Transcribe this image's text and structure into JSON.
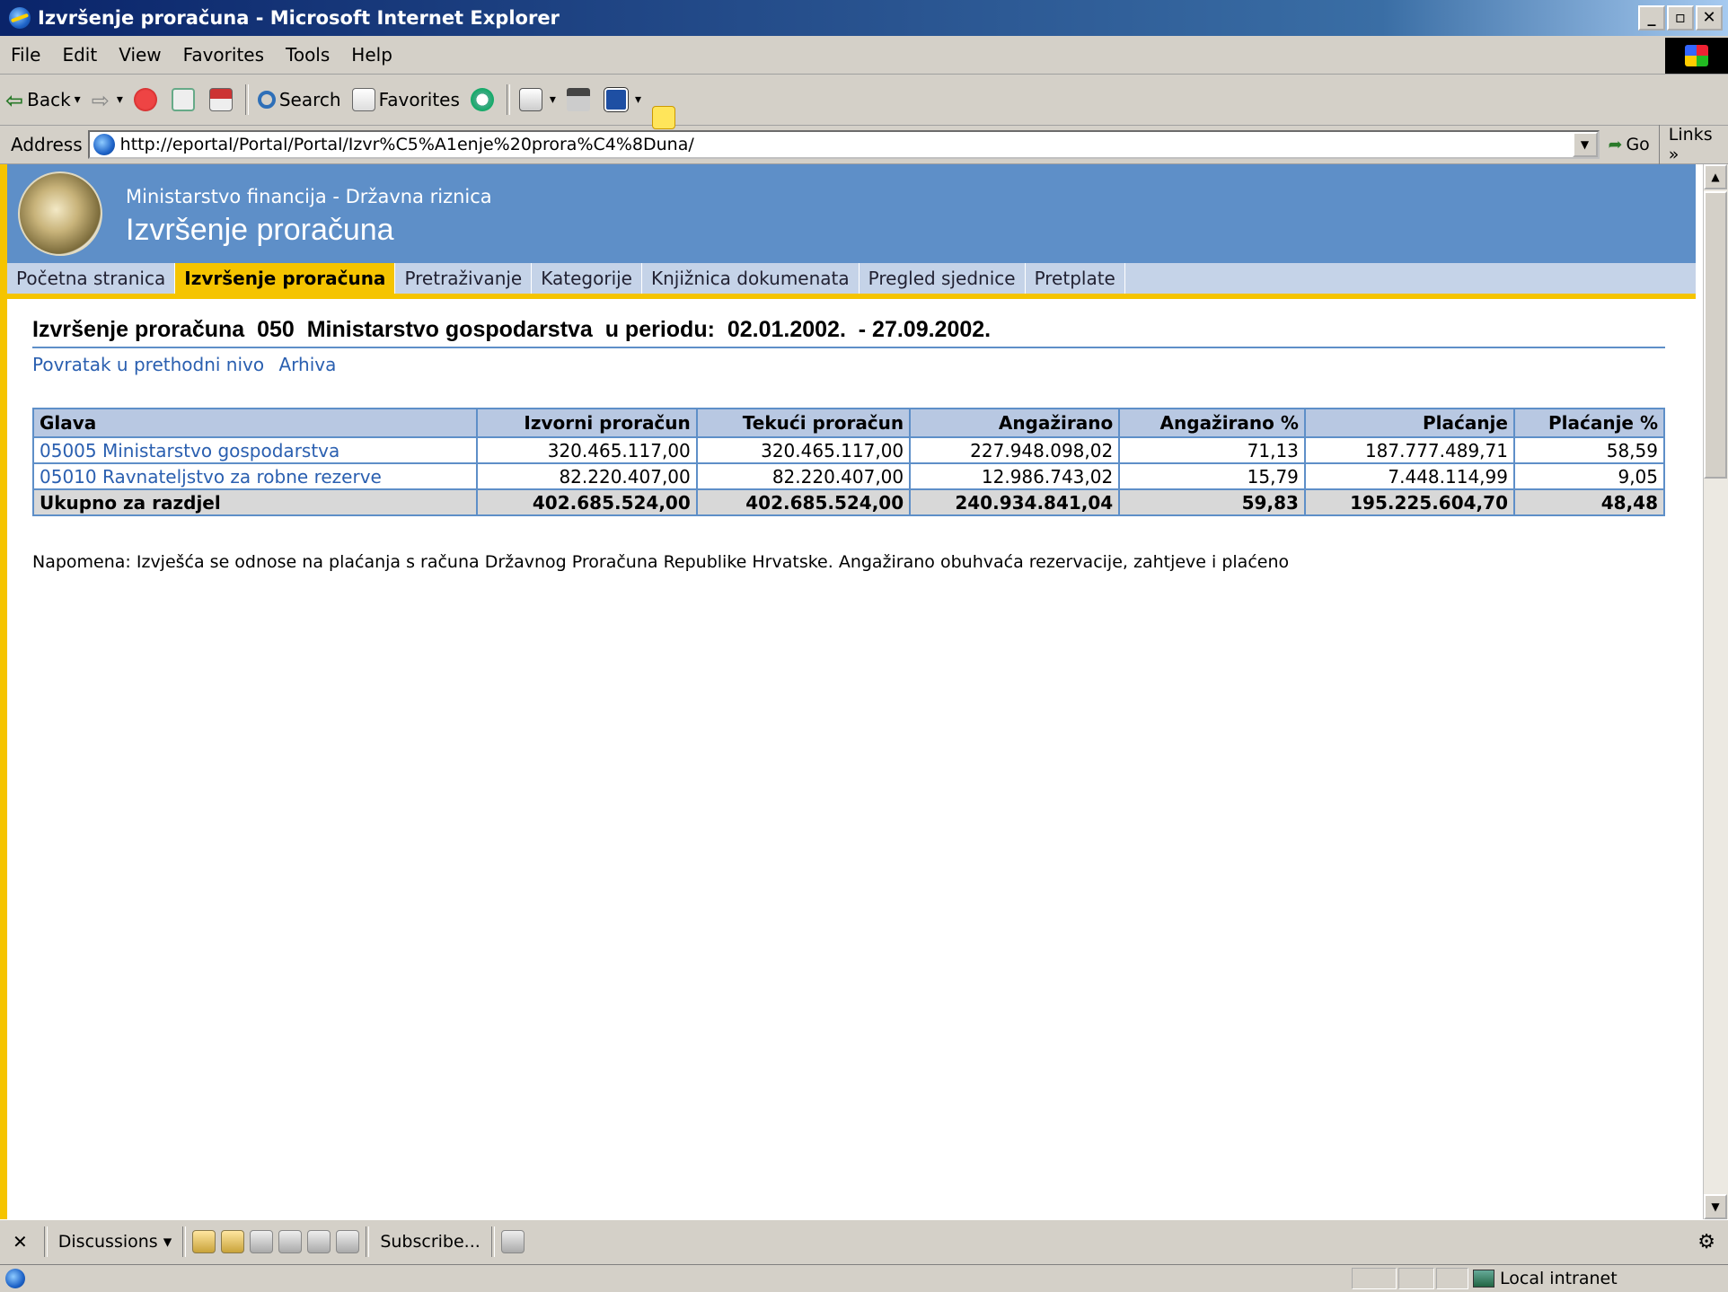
{
  "window": {
    "title": "Izvršenje proračuna - Microsoft Internet Explorer"
  },
  "menu": [
    "File",
    "Edit",
    "View",
    "Favorites",
    "Tools",
    "Help"
  ],
  "toolbar": {
    "back": "Back",
    "search": "Search",
    "favorites": "Favorites"
  },
  "address": {
    "label": "Address",
    "url": "http://eportal/Portal/Portal/Izvr%C5%A1enje%20prora%C4%8Duna/",
    "go": "Go",
    "links": "Links"
  },
  "site": {
    "subtitle": "Ministarstvo financija - Državna riznica",
    "title": "Izvršenje proračuna"
  },
  "nav": [
    "Početna stranica",
    "Izvršenje proračuna",
    "Pretraživanje",
    "Kategorije",
    "Knjižnica dokumenata",
    "Pregled sjednice",
    "Pretplate"
  ],
  "page": {
    "title": "Izvršenje proračuna  050  Ministarstvo gospodarstva  u periodu:  02.01.2002.  - 27.09.2002.",
    "back_link": "Povratak u prethodni nivo",
    "archive_link": "Arhiva",
    "note": "Napomena: Izvješća se odnose na plaćanja s računa Državnog Proračuna Republike Hrvatske. Angažirano obuhvaća rezervacije, zahtjeve i plaćeno"
  },
  "table": {
    "headers": [
      "Glava",
      "Izvorni proračun",
      "Tekući proračun",
      "Angažirano",
      "Angažirano %",
      "Plaćanje",
      "Plaćanje %"
    ],
    "rows": [
      [
        "05005 Ministarstvo gospodarstva",
        "320.465.117,00",
        "320.465.117,00",
        "227.948.098,02",
        "71,13",
        "187.777.489,71",
        "58,59"
      ],
      [
        "05010 Ravnateljstvo za robne rezerve",
        "82.220.407,00",
        "82.220.407,00",
        "12.986.743,02",
        "15,79",
        "7.448.114,99",
        "9,05"
      ]
    ],
    "total": [
      "Ukupno za razdjel",
      "402.685.524,00",
      "402.685.524,00",
      "240.934.841,04",
      "59,83",
      "195.225.604,70",
      "48,48"
    ]
  },
  "discussions": {
    "label": "Discussions",
    "subscribe": "Subscribe..."
  },
  "status": {
    "zone": "Local intranet"
  }
}
